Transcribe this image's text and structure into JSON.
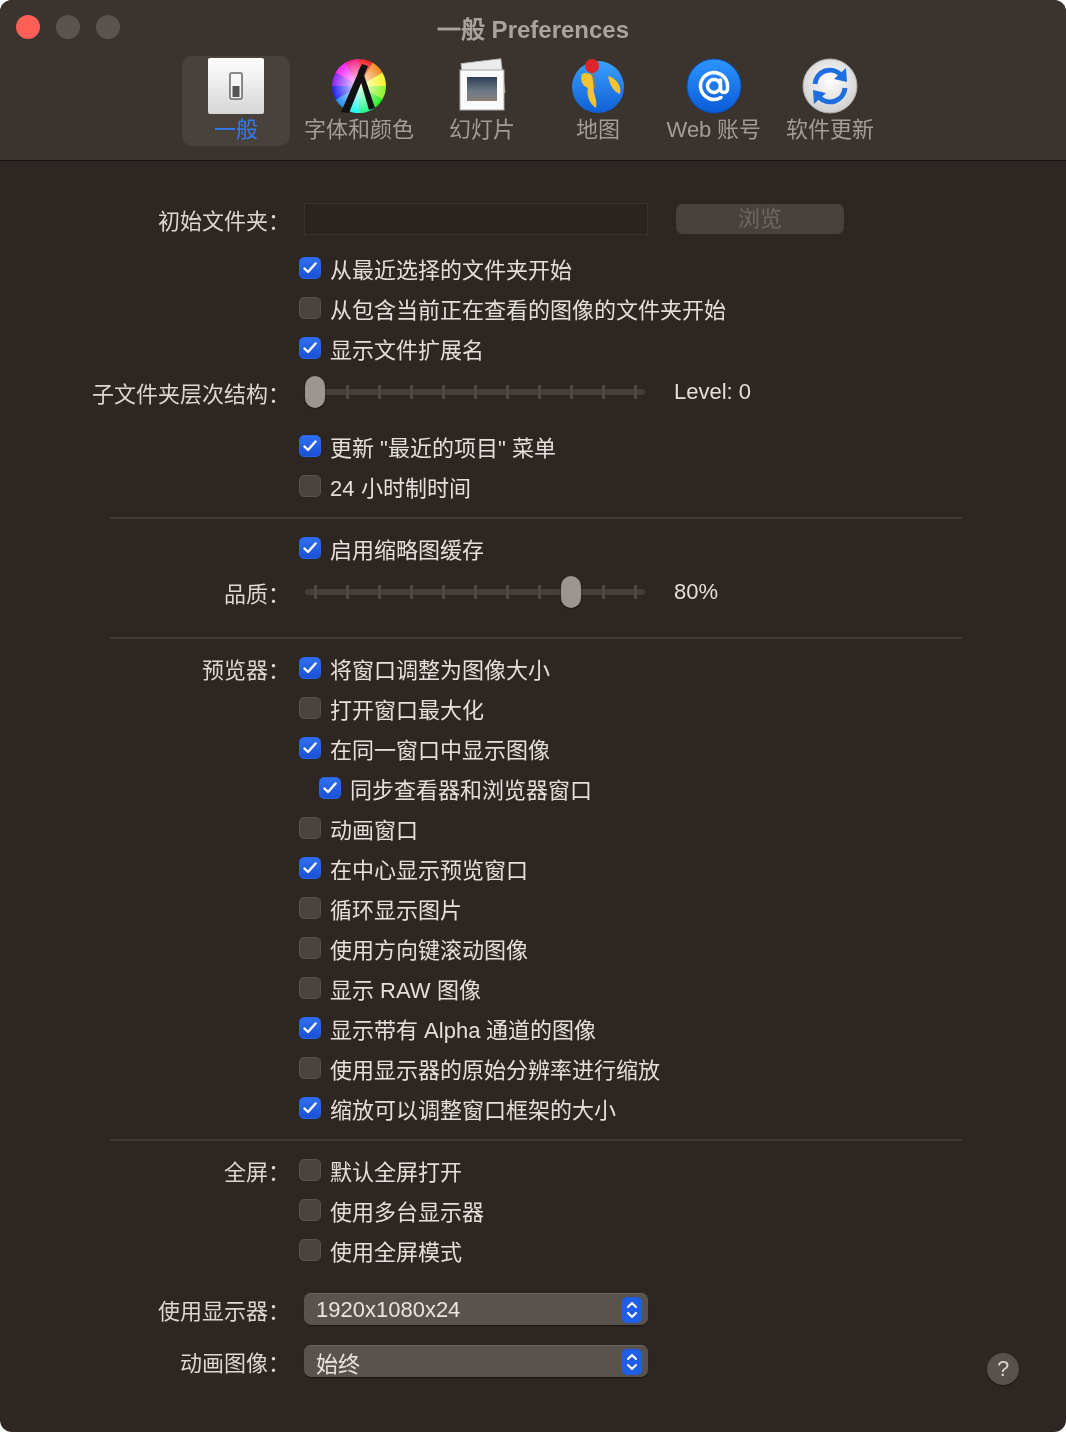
{
  "window": {
    "title": "一般 Preferences",
    "buttons": [
      {
        "kind": "close",
        "enabled": true
      },
      {
        "kind": "minimize",
        "enabled": false
      },
      {
        "kind": "zoom",
        "enabled": false
      }
    ]
  },
  "toolbar": [
    {
      "kind": "general",
      "label": "一般",
      "selected": true
    },
    {
      "kind": "fonts",
      "label": "字体和颜色",
      "selected": false
    },
    {
      "kind": "slideshow",
      "label": "幻灯片",
      "selected": false
    },
    {
      "kind": "map",
      "label": "地图",
      "selected": false
    },
    {
      "kind": "web",
      "label": "Web 账号",
      "selected": false
    },
    {
      "kind": "update",
      "label": "软件更新",
      "selected": false
    }
  ],
  "groups": [
    {
      "rows": [
        {
          "kind": "folder",
          "label": "初始文件夹：",
          "button": {
            "label": "浏览",
            "disabled": true
          }
        },
        {
          "kind": "checkbox",
          "text": "从最近选择的文件夹开始",
          "checked": true
        },
        {
          "kind": "checkbox",
          "text": "从包含当前正在查看的图像的文件夹开始",
          "checked": false
        },
        {
          "kind": "checkbox",
          "text": "显示文件扩展名",
          "checked": true
        },
        {
          "kind": "slider",
          "label": "子文件夹层次结构：",
          "level": 0,
          "reading": "Level: 0"
        },
        {
          "kind": "checkbox",
          "text": "更新 \"最近的项目\" 菜单",
          "checked": true
        },
        {
          "kind": "checkbox",
          "text": "24 小时制时间",
          "checked": false
        }
      ]
    },
    {
      "rows": [
        {
          "kind": "checkbox",
          "text": "启用缩略图缓存",
          "checked": true
        },
        {
          "kind": "slider",
          "label": "品质：",
          "level": 0.8,
          "reading": "80%"
        }
      ]
    },
    {
      "rows": [
        {
          "kind": "checkbox",
          "label": "预览器：",
          "text": "将窗口调整为图像大小",
          "checked": true
        },
        {
          "kind": "checkbox",
          "text": "打开窗口最大化",
          "checked": false
        },
        {
          "kind": "checkbox",
          "text": "在同一窗口中显示图像",
          "checked": true,
          "children": [
            {
              "kind": "checkbox",
              "text": "同步查看器和浏览器窗口",
              "checked": true
            }
          ]
        },
        {
          "kind": "checkbox",
          "text": "动画窗口",
          "checked": false
        },
        {
          "kind": "checkbox",
          "text": "在中心显示预览窗口",
          "checked": true
        },
        {
          "kind": "checkbox",
          "text": "循环显示图片",
          "checked": false
        },
        {
          "kind": "checkbox",
          "text": "使用方向键滚动图像",
          "checked": false
        },
        {
          "kind": "checkbox",
          "text": "显示 RAW 图像",
          "checked": false
        },
        {
          "kind": "checkbox",
          "text": "显示带有 Alpha 通道的图像",
          "checked": true
        },
        {
          "kind": "checkbox",
          "text": "使用显示器的原始分辨率进行缩放",
          "checked": false
        },
        {
          "kind": "checkbox",
          "text": "缩放可以调整窗口框架的大小",
          "checked": true
        }
      ]
    },
    {
      "rows": [
        {
          "kind": "checkbox",
          "label": "全屏：",
          "text": "默认全屏打开",
          "checked": false
        },
        {
          "kind": "checkbox",
          "text": "使用多台显示器",
          "checked": false
        },
        {
          "kind": "checkbox",
          "text": "使用全屏模式",
          "checked": false
        }
      ]
    }
  ],
  "popups": [
    {
      "label": "使用显示器：",
      "value": "1920x1080x24"
    },
    {
      "label": "动画图像：",
      "value": "始终"
    }
  ],
  "help": "?"
}
